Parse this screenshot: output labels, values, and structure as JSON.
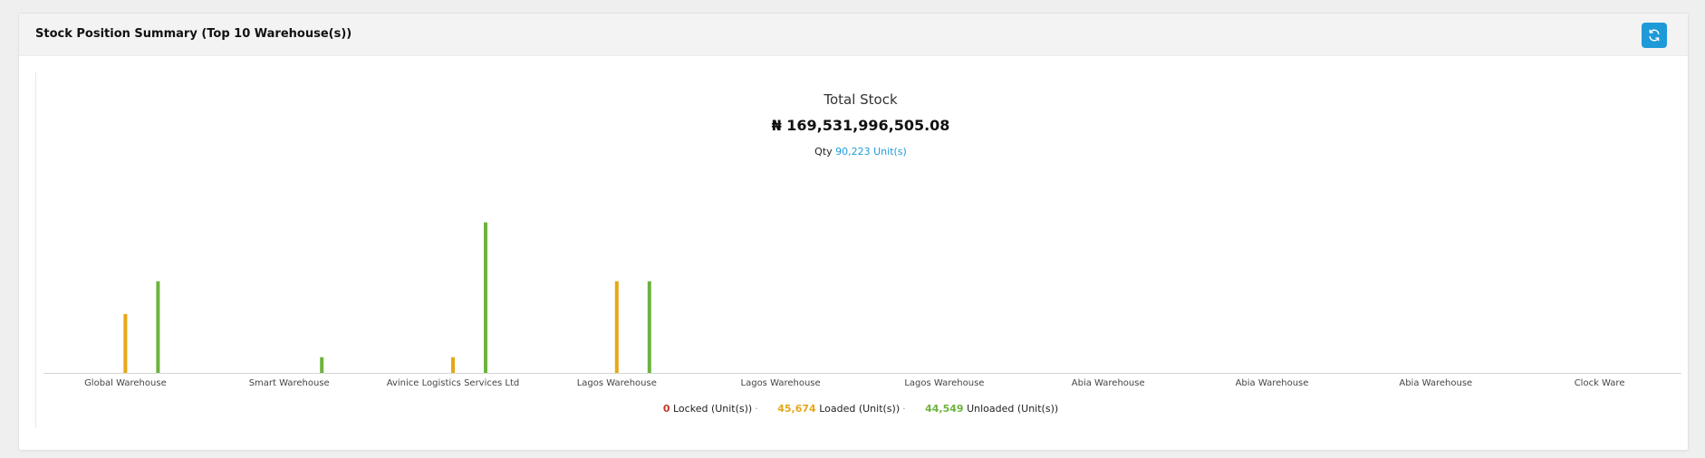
{
  "header": {
    "title": "Stock Position Summary (Top 10 Warehouse(s))"
  },
  "summary": {
    "title": "Total Stock",
    "total": "₦ 169,531,996,505.08",
    "qty_label": "Qty",
    "qty_value": "90,223 Unit(s)"
  },
  "legend": [
    {
      "value": "0",
      "label": "Locked (Unit(s))",
      "color": "#c0392b"
    },
    {
      "value": "45,674",
      "label": "Loaded (Unit(s))",
      "color": "#e6a817"
    },
    {
      "value": "44,549",
      "label": "Unloaded (Unit(s))",
      "color": "#6db33f"
    }
  ],
  "chart_data": {
    "type": "bar",
    "categories": [
      "Global Warehouse",
      "Smart Warehouse",
      "Avinice Logistics Services Ltd",
      "Lagos Warehouse",
      "Lagos Warehouse",
      "Lagos Warehouse",
      "Abia Warehouse",
      "Abia Warehouse",
      "Abia Warehouse",
      "Clock Ware"
    ],
    "series": [
      {
        "name": "Locked (Unit(s))",
        "color": "#c0392b",
        "values": [
          0,
          0,
          0,
          0,
          0,
          0,
          0,
          0,
          0,
          0
        ]
      },
      {
        "name": "Loaded (Unit(s))",
        "color": "#e6a817",
        "values": [
          9000,
          0,
          2400,
          14000,
          0,
          0,
          0,
          0,
          0,
          0
        ]
      },
      {
        "name": "Unloaded (Unit(s))",
        "color": "#6db33f",
        "values": [
          14000,
          2400,
          23000,
          14000,
          0,
          0,
          0,
          0,
          0,
          0
        ]
      }
    ],
    "ylim": [
      0,
      26000
    ],
    "grid": false,
    "legend_position": "bottom"
  }
}
